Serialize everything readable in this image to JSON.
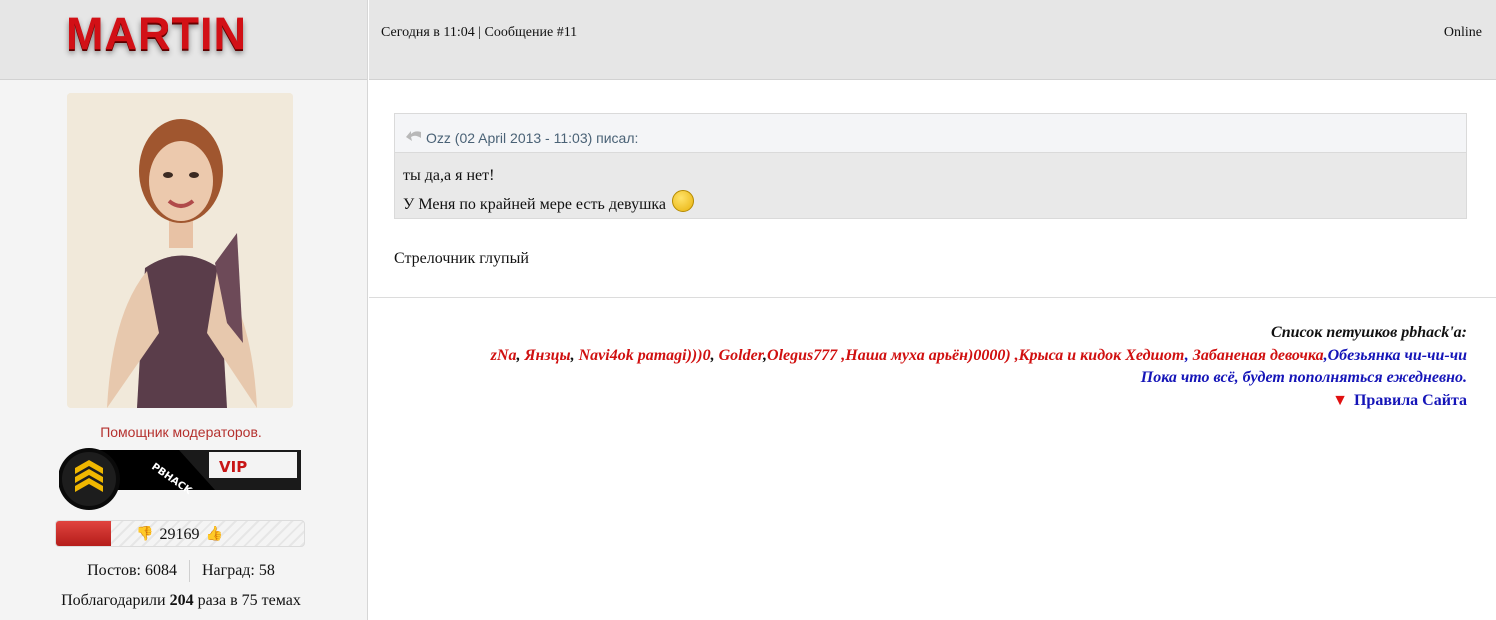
{
  "author": {
    "username": "MARTIN",
    "role": "Помощник модераторов.",
    "rank_badge": {
      "brand": "PBHACK",
      "label": "VIP"
    },
    "reputation": {
      "value": "29169",
      "fill_fraction": 0.22
    },
    "stats": {
      "posts": "Постов: 6084",
      "awards": "Наград: 58"
    },
    "thanks": {
      "prefix": "Поблагодарили ",
      "count": "204",
      "suffix": " раза в 75 темах"
    }
  },
  "post": {
    "meta": "Сегодня в 11:04 | Сообщение #11",
    "status": "Online",
    "quote": {
      "header": "Ozz (02 April 2013 - 11:03) писал:",
      "line1": "ты да,а я нет!",
      "line2": "У Меня по крайней мере есть девушка"
    },
    "message": "Стрелочник глупый"
  },
  "signature": {
    "title": "Список петушков pbhack'a:",
    "items": [
      {
        "text": "zNa",
        "color": "red"
      },
      {
        "text": ", ",
        "color": "black"
      },
      {
        "text": "Янзцы",
        "color": "red"
      },
      {
        "text": ", ",
        "color": "black"
      },
      {
        "text": "Navi4ok pamagi)))0",
        "color": "red"
      },
      {
        "text": ", ",
        "color": "black"
      },
      {
        "text": "Golder",
        "color": "red"
      },
      {
        "text": ",",
        "color": "black"
      },
      {
        "text": "Olegus777 ,Наша муха арьён)0000) ,",
        "color": "red"
      },
      {
        "text": "Крыса и кидок Хедшот",
        "color": "red"
      },
      {
        "text": ", ",
        "color": "blue"
      },
      {
        "text": "Забаненая девочка",
        "color": "red"
      },
      {
        "text": ",Обезьянка чи-чи-чи",
        "color": "blue"
      }
    ],
    "note": "Пока что всё, будет пополняться ежедневно.",
    "rules_link": "Правила Сайта"
  },
  "colors": {
    "accent_red": "#d21016",
    "sig_red": "#d01010",
    "sig_blue": "#1515b8",
    "role": "#b5312e"
  }
}
